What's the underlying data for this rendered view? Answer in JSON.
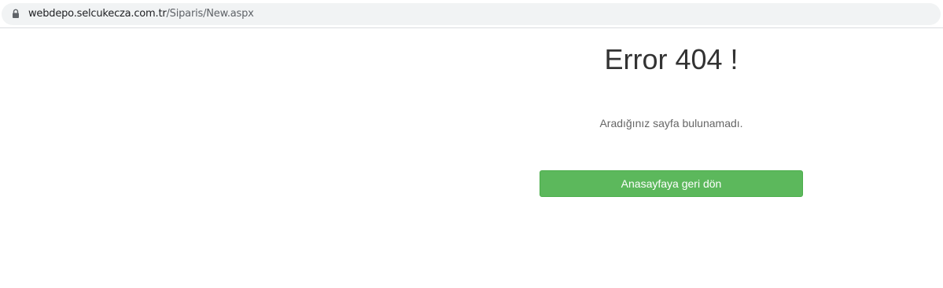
{
  "browser": {
    "url_host": "webdepo.selcukecza.com.tr",
    "url_path": "/Siparis/New.aspx",
    "lock_icon": "lock-icon"
  },
  "error": {
    "title": "Error 404 !",
    "message": "Aradığınız sayfa bulunamadı.",
    "home_button_label": "Anasayfaya geri dön"
  },
  "colors": {
    "button_bg": "#5cb85c",
    "title_text": "#333333",
    "message_text": "#666666"
  }
}
